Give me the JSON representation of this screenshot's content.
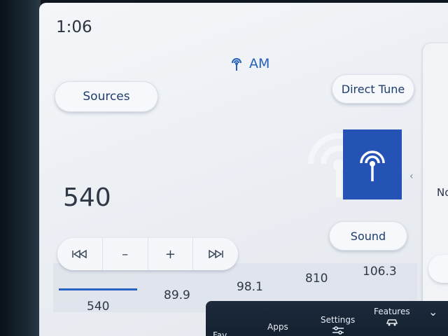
{
  "status": {
    "clock": "1:06"
  },
  "source": {
    "band": "AM",
    "icon": "radio-antenna-icon"
  },
  "buttons": {
    "sources": "Sources",
    "direct_tune": "Direct Tune",
    "sound": "Sound"
  },
  "tuning": {
    "frequency": "540",
    "controls": [
      "seek-back-icon",
      "minus-icon",
      "plus-icon",
      "seek-forward-icon"
    ],
    "minus": "–",
    "plus": "+"
  },
  "side_panel": {
    "text": "No"
  },
  "presets": [
    "540",
    "89.9",
    "98.1",
    "810",
    "106.3"
  ],
  "dock": {
    "items": [
      "Fav",
      "Apps",
      "Settings",
      "Features"
    ]
  },
  "colors": {
    "accent": "#2553b5",
    "text": "#2f3846"
  }
}
